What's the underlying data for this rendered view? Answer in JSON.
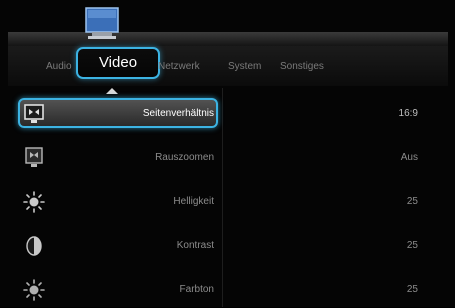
{
  "tabs": [
    {
      "label": "Audio",
      "active": false
    },
    {
      "label": "Video",
      "active": true
    },
    {
      "label": "Netzwerk",
      "active": false
    },
    {
      "label": "System",
      "active": false
    },
    {
      "label": "Sonstiges",
      "active": false
    }
  ],
  "active_tab_icon": "tv-monitor-icon",
  "accent_color": "#3cb3e3",
  "settings": [
    {
      "label": "Seitenverhältnis",
      "value": "16:9",
      "icon": "aspect-ratio-icon",
      "selected": true
    },
    {
      "label": "Rauszoomen",
      "value": "Aus",
      "icon": "zoom-out-icon",
      "selected": false
    },
    {
      "label": "Helligkeit",
      "value": "25",
      "icon": "brightness-icon",
      "selected": false
    },
    {
      "label": "Kontrast",
      "value": "25",
      "icon": "contrast-icon",
      "selected": false
    },
    {
      "label": "Farbton",
      "value": "25",
      "icon": "hue-icon",
      "selected": false
    }
  ]
}
